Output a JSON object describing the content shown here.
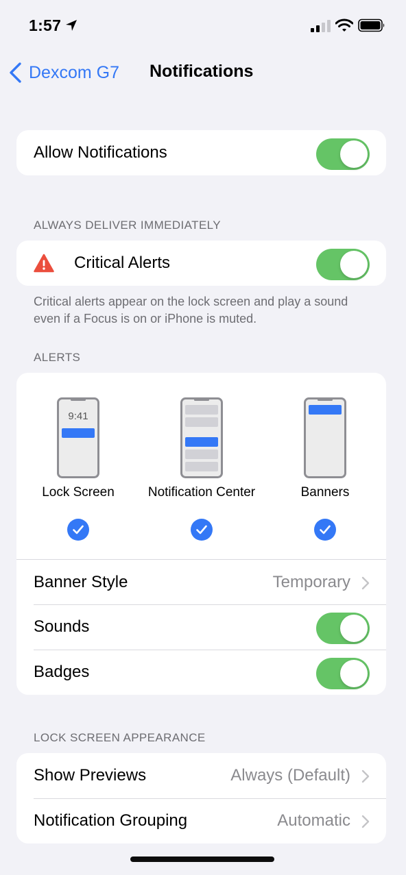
{
  "status_bar": {
    "time": "1:57",
    "location_icon": "location-arrow-icon",
    "signal_icon": "cellular-signal-icon",
    "wifi_icon": "wifi-icon",
    "battery_icon": "battery-icon"
  },
  "nav": {
    "back_label": "Dexcom G7",
    "back_icon": "chevron-left-icon",
    "title": "Notifications"
  },
  "allow_notifications": {
    "label": "Allow Notifications",
    "on": true
  },
  "always_deliver": {
    "header": "ALWAYS DELIVER IMMEDIATELY",
    "critical_alerts": {
      "label": "Critical Alerts",
      "icon": "warning-triangle-icon",
      "on": true
    },
    "footer": "Critical alerts appear on the lock screen and play a sound even if a Focus is on or iPhone is muted."
  },
  "alerts": {
    "header": "ALERTS",
    "styles": [
      {
        "label": "Lock Screen",
        "checked": true,
        "preview_time": "9:41"
      },
      {
        "label": "Notification Center",
        "checked": true
      },
      {
        "label": "Banners",
        "checked": true
      }
    ],
    "banner_style": {
      "label": "Banner Style",
      "value": "Temporary"
    },
    "sounds": {
      "label": "Sounds",
      "on": true
    },
    "badges": {
      "label": "Badges",
      "on": true
    }
  },
  "lock_screen": {
    "header": "LOCK SCREEN APPEARANCE",
    "show_previews": {
      "label": "Show Previews",
      "value": "Always (Default)"
    },
    "grouping": {
      "label": "Notification Grouping",
      "value": "Automatic"
    }
  },
  "colors": {
    "accent": "#3478f6",
    "toggle_on": "#65c466",
    "warning": "#eb4e3d",
    "background": "#f2f2f7"
  }
}
